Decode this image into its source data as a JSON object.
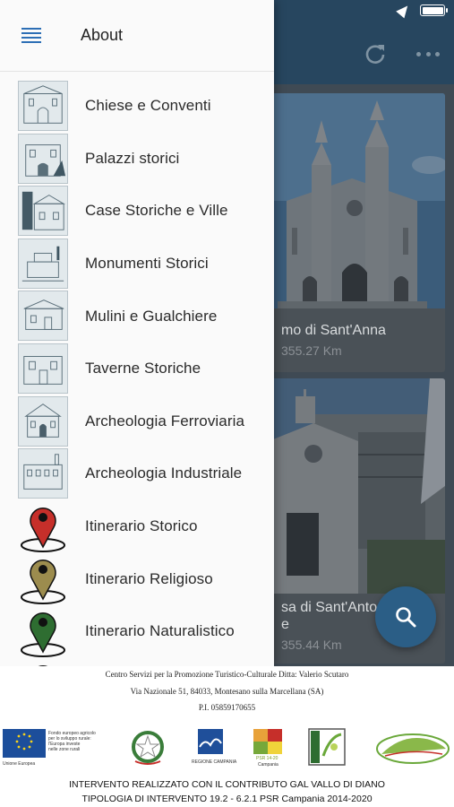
{
  "background": {
    "cards": [
      {
        "title": "mo di Sant'Anna",
        "distance": "355.27 Km"
      },
      {
        "title": "sa di Sant'Anto",
        "title_line2": "e",
        "distance": "355.44 Km"
      }
    ],
    "icons": {
      "refresh": "refresh-icon",
      "more": "more-icon",
      "search": "search-icon"
    }
  },
  "drawer": {
    "title": "About",
    "items": [
      {
        "label": "Chiese e Conventi",
        "icon": "thumbnail"
      },
      {
        "label": "Palazzi storici",
        "icon": "thumbnail"
      },
      {
        "label": "Case Storiche e Ville",
        "icon": "thumbnail"
      },
      {
        "label": "Monumenti Storici",
        "icon": "thumbnail"
      },
      {
        "label": "Mulini e Gualchiere",
        "icon": "thumbnail"
      },
      {
        "label": "Taverne Storiche",
        "icon": "thumbnail"
      },
      {
        "label": "Archeologia Ferroviaria",
        "icon": "thumbnail"
      },
      {
        "label": "Archeologia Industriale",
        "icon": "thumbnail"
      },
      {
        "label": "Itinerario Storico",
        "icon": "map-pin",
        "color": "#c62f2a"
      },
      {
        "label": "Itinerario Religioso",
        "icon": "map-pin",
        "color": "#9c8c4e"
      },
      {
        "label": "Itinerario Naturalistico",
        "icon": "map-pin",
        "color": "#2e6d31"
      }
    ]
  },
  "footer": {
    "line1": "Centro Servizi per la Promozione Turistico-Culturale  Ditta: Valerio Scutaro",
    "line2": "Via Nazionale 51, 84033,  Montesano sulla Marcellana (SA)",
    "line3": "P.I. 05859170655",
    "eu_caption": [
      "Fondo europeo agricolo",
      "per lo sviluppo rurale:",
      "l'Europa investe",
      "nelle zone rurali"
    ],
    "eu_label": "Unione Europea",
    "campania_label": "REGIONE CAMPANIA",
    "psr_label": "PSR 14-20",
    "psr_sub": "Campania",
    "leader_label": "LEADER",
    "caps1": "INTERVENTO REALIZZATO CON IL CONTRIBUTO GAL VALLO DI DIANO",
    "caps2": "TIPOLOGIA DI INTERVENTO 19.2 - 6.2.1 PSR Campania 2014-2020"
  },
  "colors": {
    "accent": "#2d6fb5",
    "header": "#27465f",
    "fab": "#2b5e86"
  }
}
